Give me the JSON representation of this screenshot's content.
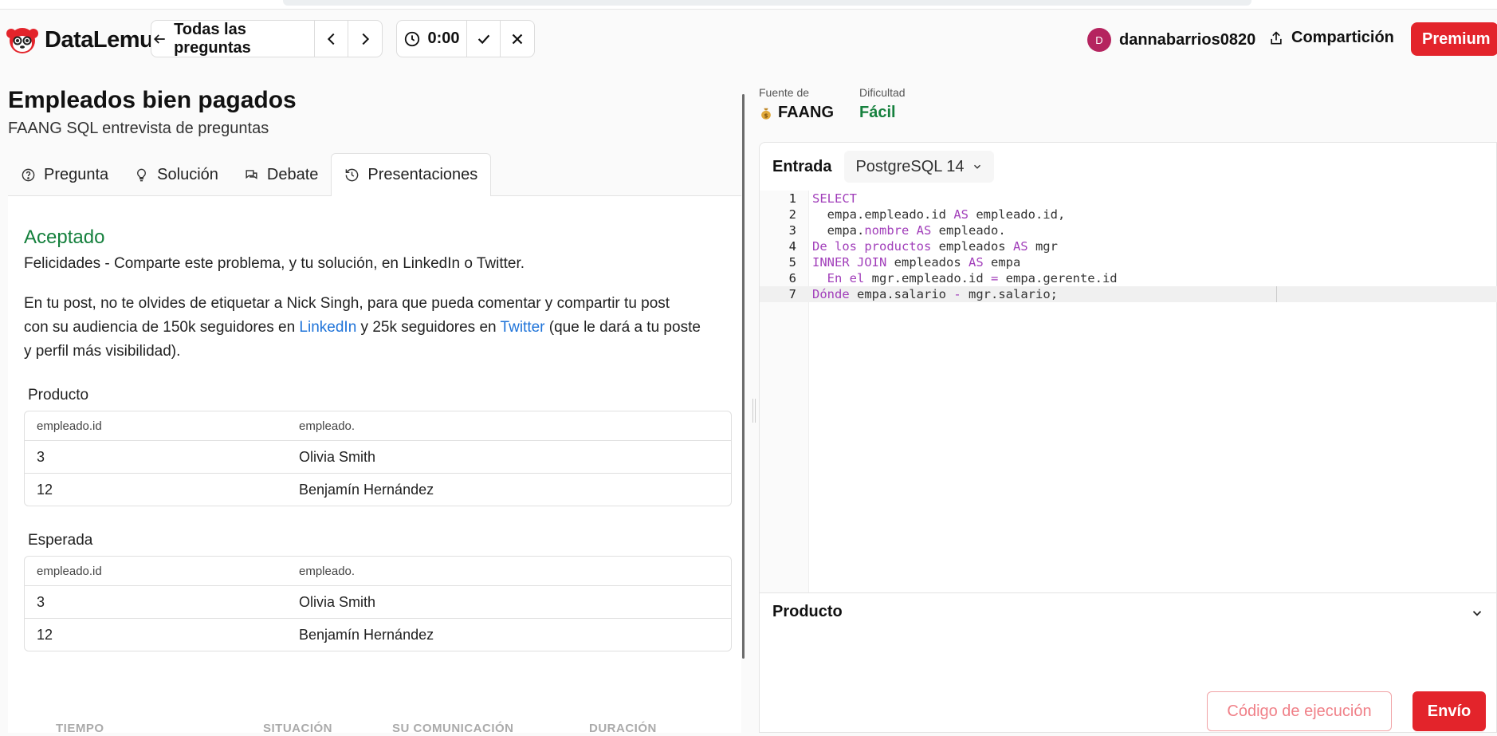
{
  "header": {
    "brand": "DataLemur",
    "all_questions": "Todas las preguntas",
    "timer": "0:00",
    "username": "dannabarrios0820",
    "avatar_letter": "D",
    "share": "Compartición",
    "premium": "Premium"
  },
  "problem": {
    "title": "Empleados bien pagados",
    "subtitle": "FAANG SQL entrevista de preguntas"
  },
  "tabs": [
    {
      "label": "Pregunta",
      "icon": "question-circle-icon"
    },
    {
      "label": "Solución",
      "icon": "lightbulb-icon"
    },
    {
      "label": "Debate",
      "icon": "chat-icon"
    },
    {
      "label": "Presentaciones",
      "icon": "history-icon",
      "active": true
    }
  ],
  "submission": {
    "status": "Aceptado",
    "congrats": "Felicidades - Comparte este problema, y tu solución, en LinkedIn o Twitter.",
    "post_tip_1": "En tu post, no te olvides de etiquetar a Nick Singh, para que pueda comentar y compartir tu post",
    "post_tip_2a": "con su audiencia de 150k seguidores en ",
    "linkedin": "LinkedIn",
    "post_tip_2b": " y 25k seguidores en ",
    "twitter": "Twitter",
    "post_tip_2c": " (que le dará a tu poste",
    "post_tip_3": "y perfil más visibilidad)."
  },
  "output_table": {
    "label": "Producto",
    "columns": [
      "empleado.id",
      "empleado."
    ],
    "rows": [
      [
        "3",
        "Olivia Smith"
      ],
      [
        "12",
        "Benjamín Hernández"
      ]
    ]
  },
  "expected_table": {
    "label": "Esperada",
    "columns": [
      "empleado.id",
      "empleado."
    ],
    "rows": [
      [
        "3",
        "Olivia Smith"
      ],
      [
        "12",
        "Benjamín Hernández"
      ]
    ]
  },
  "history": {
    "columns": [
      "TIEMPO",
      "SITUACIÓN",
      "SU COMUNICACIÓN",
      "DURACIÓN"
    ]
  },
  "meta": {
    "source_label": "Fuente de",
    "source_value": "FAANG",
    "source_icon": "money-bag-icon",
    "difficulty_label": "Dificultad",
    "difficulty_value": "Fácil",
    "difficulty_color": "#15803d"
  },
  "editor": {
    "input_label": "Entrada",
    "language": "PostgreSQL 14",
    "lines": [
      "SELECT",
      "  empa.empleado.id AS empleado.id,",
      "  empa.nombre AS empleado.",
      "De los productos empleados AS mgr",
      "INNER JOIN empleados AS empa",
      "  En el mgr.empleado.id = empa.gerente.id",
      "Dónde empa.salario - mgr.salario;"
    ],
    "line_numbers": [
      "1",
      "2",
      "3",
      "4",
      "5",
      "6",
      "7"
    ],
    "current_line": 7
  },
  "output_panel": {
    "title": "Producto"
  },
  "buttons": {
    "run": "Código de ejecución",
    "submit": "Envío"
  },
  "colors": {
    "accent": "#e3242b",
    "link": "#1e73d9",
    "keyword": "#a13eba",
    "accepted": "#15803d"
  }
}
